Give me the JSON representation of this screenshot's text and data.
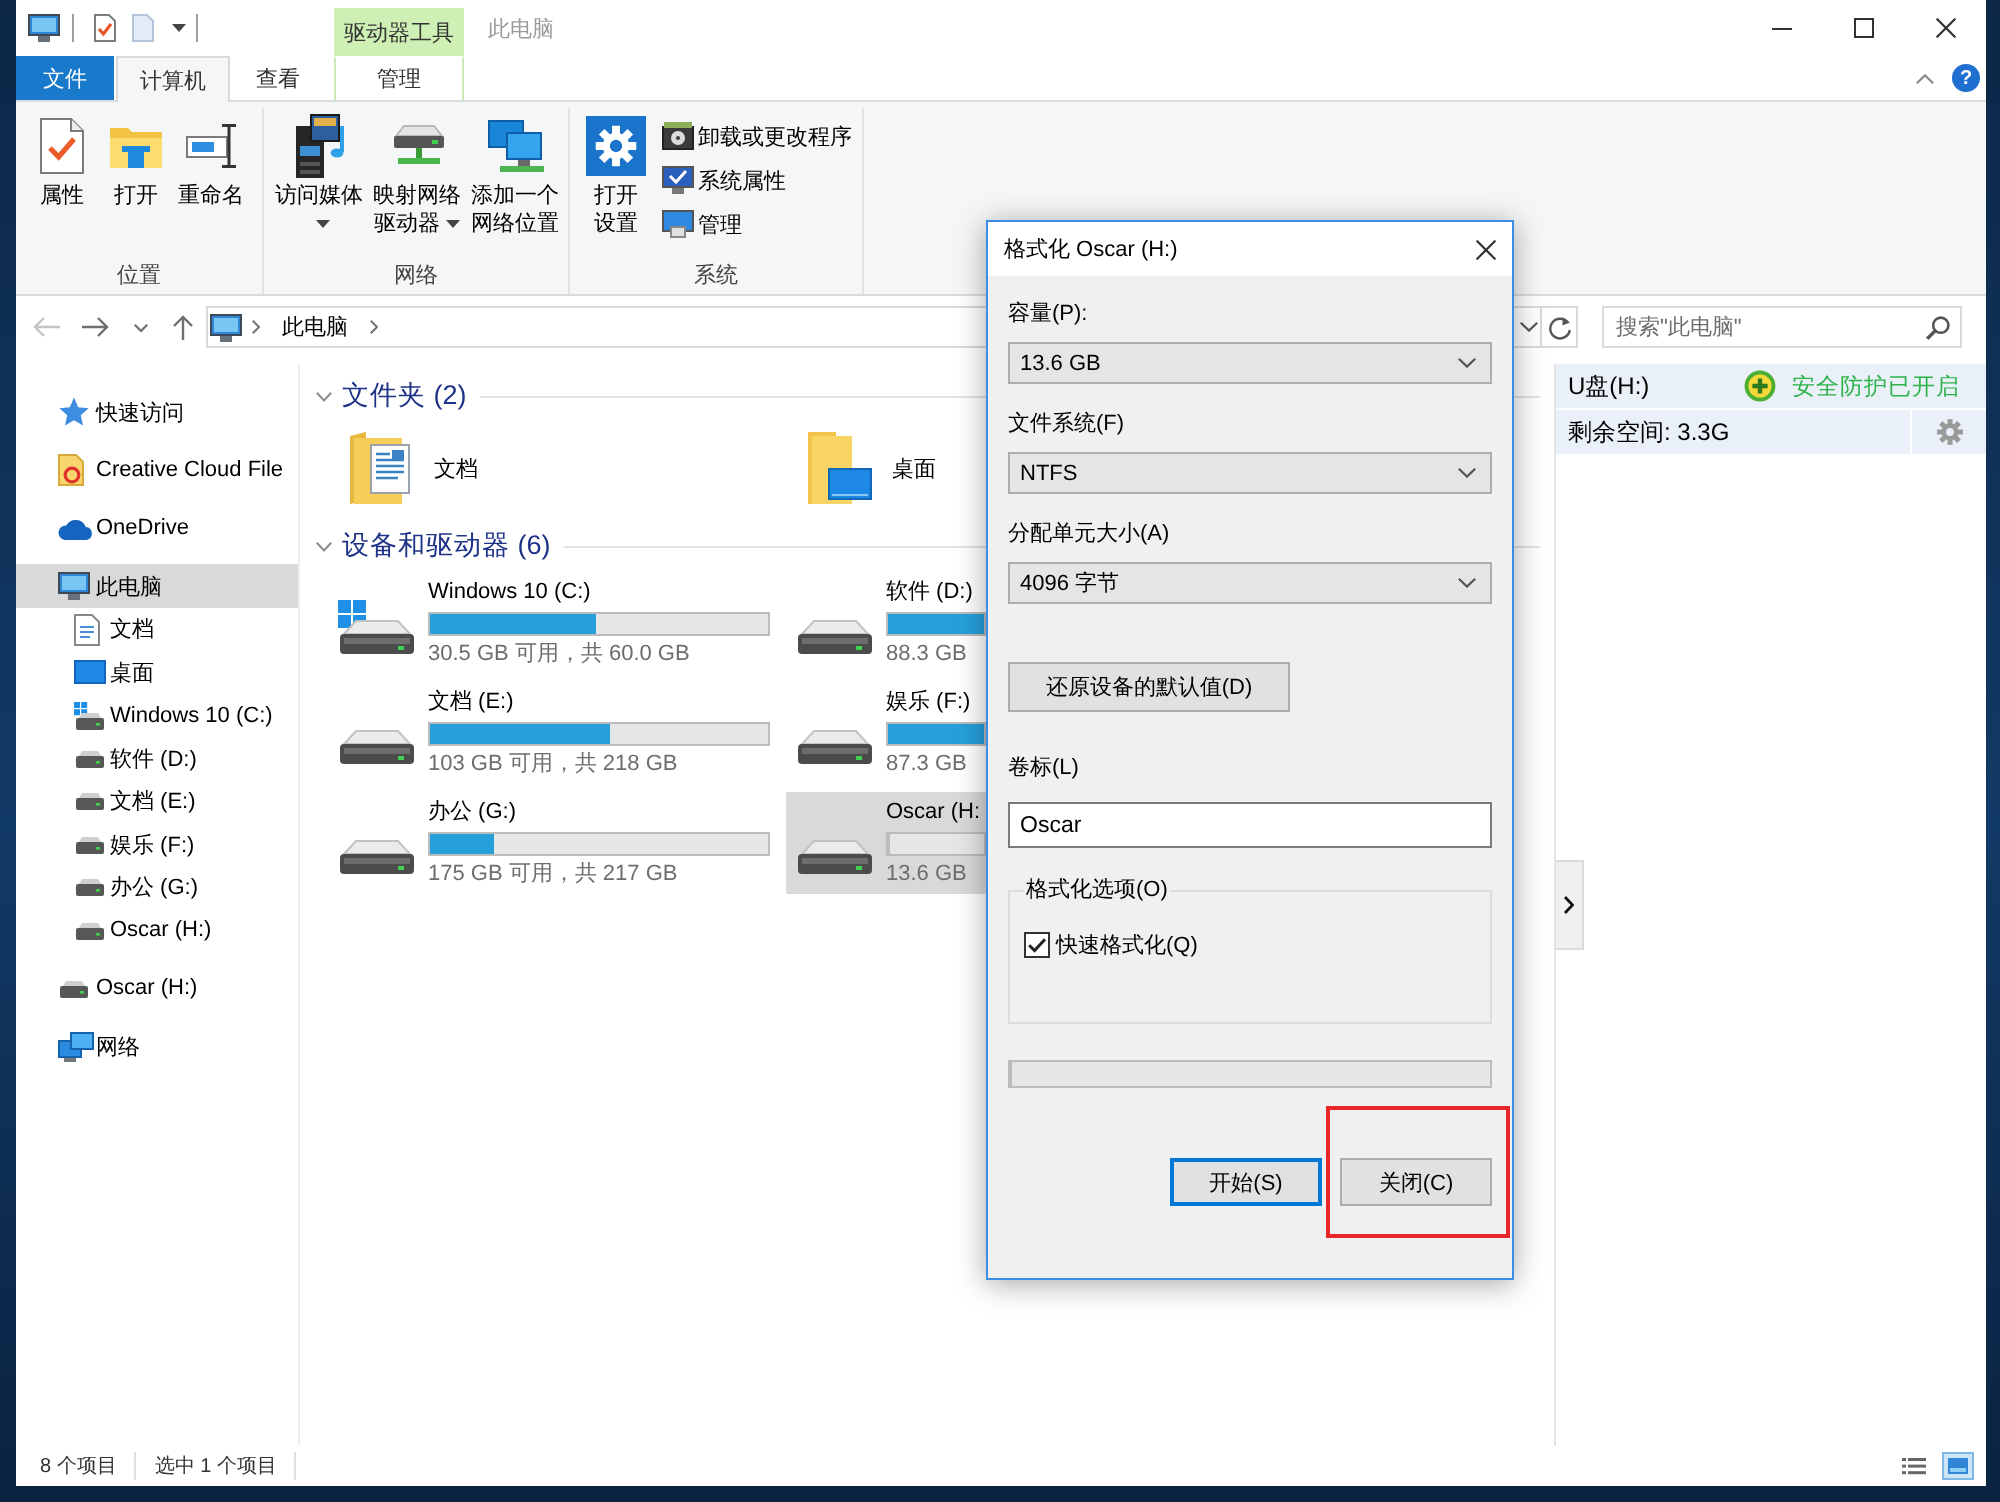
{
  "window": {
    "title": "此电脑",
    "context_group": "驱动器工具"
  },
  "ribbon": {
    "tabs": [
      {
        "label": "文件",
        "kind": "file",
        "selected": false
      },
      {
        "label": "计算机",
        "kind": "tab",
        "selected": true
      },
      {
        "label": "查看",
        "kind": "tab",
        "selected": false
      },
      {
        "label": "管理",
        "kind": "context",
        "selected": false
      }
    ],
    "help": "?",
    "groups": [
      {
        "label": "位置",
        "buttons": [
          {
            "label": "属性",
            "kind": "large",
            "dropdown": false
          },
          {
            "label": "打开",
            "kind": "large",
            "dropdown": false
          },
          {
            "label": "重命名",
            "kind": "large",
            "dropdown": false
          }
        ]
      },
      {
        "label": "网络",
        "buttons": [
          {
            "label": "访问媒体",
            "kind": "large",
            "dropdown": true
          },
          {
            "label": "映射网络驱动器",
            "kind": "large",
            "dropdown": true
          },
          {
            "label": "添加一个网络位置",
            "kind": "large",
            "dropdown": false
          }
        ]
      },
      {
        "label": "系统",
        "buttons": [
          {
            "label": "打开设置",
            "kind": "large",
            "dropdown": false
          },
          {
            "label": "卸载或更改程序",
            "kind": "small",
            "dropdown": false
          },
          {
            "label": "系统属性",
            "kind": "small",
            "dropdown": false
          },
          {
            "label": "管理",
            "kind": "small",
            "dropdown": false
          }
        ]
      }
    ]
  },
  "address_bar": {
    "buttons": [
      {
        "kind": "back",
        "disabled": true
      },
      {
        "kind": "forward",
        "disabled": false
      },
      {
        "kind": "recent",
        "disabled": false
      },
      {
        "kind": "up",
        "disabled": false
      }
    ],
    "path": [
      "此电脑"
    ]
  },
  "search": {
    "placeholder": "搜索\"此电脑\""
  },
  "navigation": {
    "items": [
      {
        "label": "快速访问",
        "kind": "quick-access",
        "selected": false
      },
      {
        "label": "Creative Cloud File",
        "kind": "cloud-folder",
        "selected": false
      },
      {
        "label": "OneDrive",
        "kind": "onedrive",
        "selected": false
      },
      {
        "label": "此电脑",
        "kind": "computer",
        "selected": true,
        "children": [
          {
            "label": "文档",
            "kind": "documents",
            "selected": false
          },
          {
            "label": "桌面",
            "kind": "desktop",
            "selected": false
          },
          {
            "label": "Windows 10 (C:)",
            "kind": "system-drive",
            "selected": false
          },
          {
            "label": "软件 (D:)",
            "kind": "drive",
            "selected": false
          },
          {
            "label": "文档 (E:)",
            "kind": "drive",
            "selected": false
          },
          {
            "label": "娱乐 (F:)",
            "kind": "drive",
            "selected": false
          },
          {
            "label": "办公 (G:)",
            "kind": "drive",
            "selected": false
          },
          {
            "label": "Oscar (H:)",
            "kind": "drive",
            "selected": false
          }
        ]
      },
      {
        "label": "Oscar (H:)",
        "kind": "drive",
        "selected": false
      },
      {
        "label": "网络",
        "kind": "network",
        "selected": false
      }
    ]
  },
  "content": {
    "sections": [
      {
        "title": "文件夹 (2)",
        "kind": "folders",
        "expanded": true,
        "items": [
          {
            "name": "文档",
            "kind": "documents-folder",
            "selected": false
          },
          {
            "name": "桌面",
            "kind": "desktop-folder",
            "selected": false
          }
        ]
      },
      {
        "title": "设备和驱动器 (6)",
        "kind": "drives",
        "expanded": true,
        "items": [
          {
            "name": "Windows 10 (C:)",
            "kind": "system-drive",
            "level": 0.49,
            "usage": "30.5 GB 可用，共 60.0 GB",
            "selected": false
          },
          {
            "name": "软件 (D:)",
            "kind": "drive",
            "level": 1,
            "usage": "88.3 GB",
            "selected": false
          },
          {
            "name": "文档 (E:)",
            "kind": "drive",
            "level": 0.53,
            "usage": "103 GB 可用，共 218 GB",
            "selected": false
          },
          {
            "name": "娱乐 (F:)",
            "kind": "drive",
            "level": 1,
            "usage": "87.3 GB",
            "selected": false
          },
          {
            "name": "办公 (G:)",
            "kind": "drive",
            "level": 0.19,
            "usage": "175 GB 可用，共 217 GB",
            "selected": false
          },
          {
            "name": "Oscar (H:",
            "kind": "drive",
            "level": 0,
            "usage": "13.6 GB",
            "selected": true
          }
        ]
      }
    ]
  },
  "details_pane": {
    "drive": "U盘(H:)",
    "protection": "安全防护已开启",
    "free_space": "剩余空间: 3.3G"
  },
  "status_bar": {
    "item_count": "8 个项目",
    "selection": "选中 1 个项目",
    "views": [
      {
        "kind": "details",
        "selected": false
      },
      {
        "kind": "large-icons",
        "selected": true
      }
    ]
  },
  "format_dialog": {
    "title": "格式化 Oscar (H:)",
    "fields": [
      {
        "label": "容量(P):",
        "value": "13.6 GB"
      },
      {
        "label": "文件系统(F)",
        "value": "NTFS"
      },
      {
        "label": "分配单元大小(A)",
        "value": "4096 字节"
      }
    ],
    "restore_defaults": "还原设备的默认值(D)",
    "volume_label": {
      "label": "卷标(L)",
      "value": "Oscar"
    },
    "options": {
      "title": "格式化选项(O)",
      "items": [
        {
          "label": "快速格式化(Q)",
          "checked": true
        }
      ]
    },
    "progress": {
      "level": 0
    },
    "buttons": [
      {
        "label": "开始(S)",
        "default": true,
        "highlighted": false
      },
      {
        "label": "关闭(C)",
        "default": false,
        "highlighted": true
      }
    ]
  }
}
